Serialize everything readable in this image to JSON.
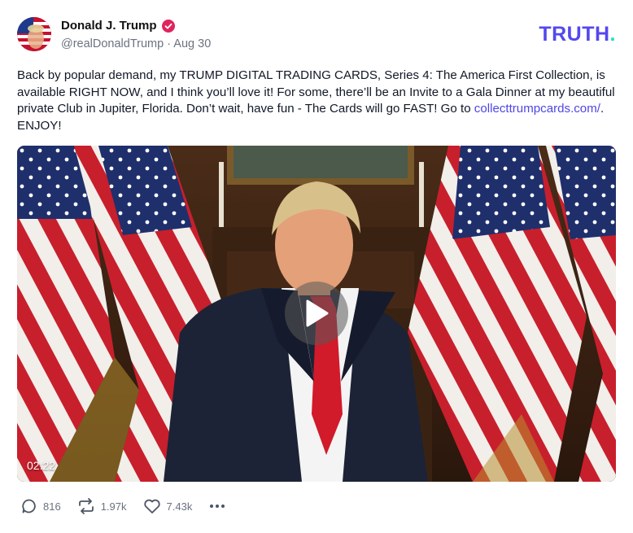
{
  "author": {
    "display_name": "Donald J. Trump",
    "handle": "@realDonaldTrump",
    "separator": " · ",
    "date": "Aug 30"
  },
  "brand": {
    "logo_text": "TRUTH",
    "logo_dot": "."
  },
  "post": {
    "text_before_link": "Back by popular demand, my TRUMP DIGITAL TRADING CARDS, Series 4: The America First Collection, is available RIGHT NOW, and I think you’ll love it! For some, there’ll be an Invite to a Gala Dinner at my beautiful private Club in Jupiter, Florida. Don’t wait, have fun - The Cards will go FAST! Go to ",
    "link_text": "collecttrumpcards.com/",
    "text_after_link": ". ENJOY!"
  },
  "video": {
    "duration": "02:22"
  },
  "actions": {
    "replies": "816",
    "retruths": "1.97k",
    "likes": "7.43k"
  },
  "colors": {
    "brand": "#5448ee",
    "brand_dot": "#17e0c9",
    "link": "#4f46e5",
    "verified": "#e0245e"
  }
}
